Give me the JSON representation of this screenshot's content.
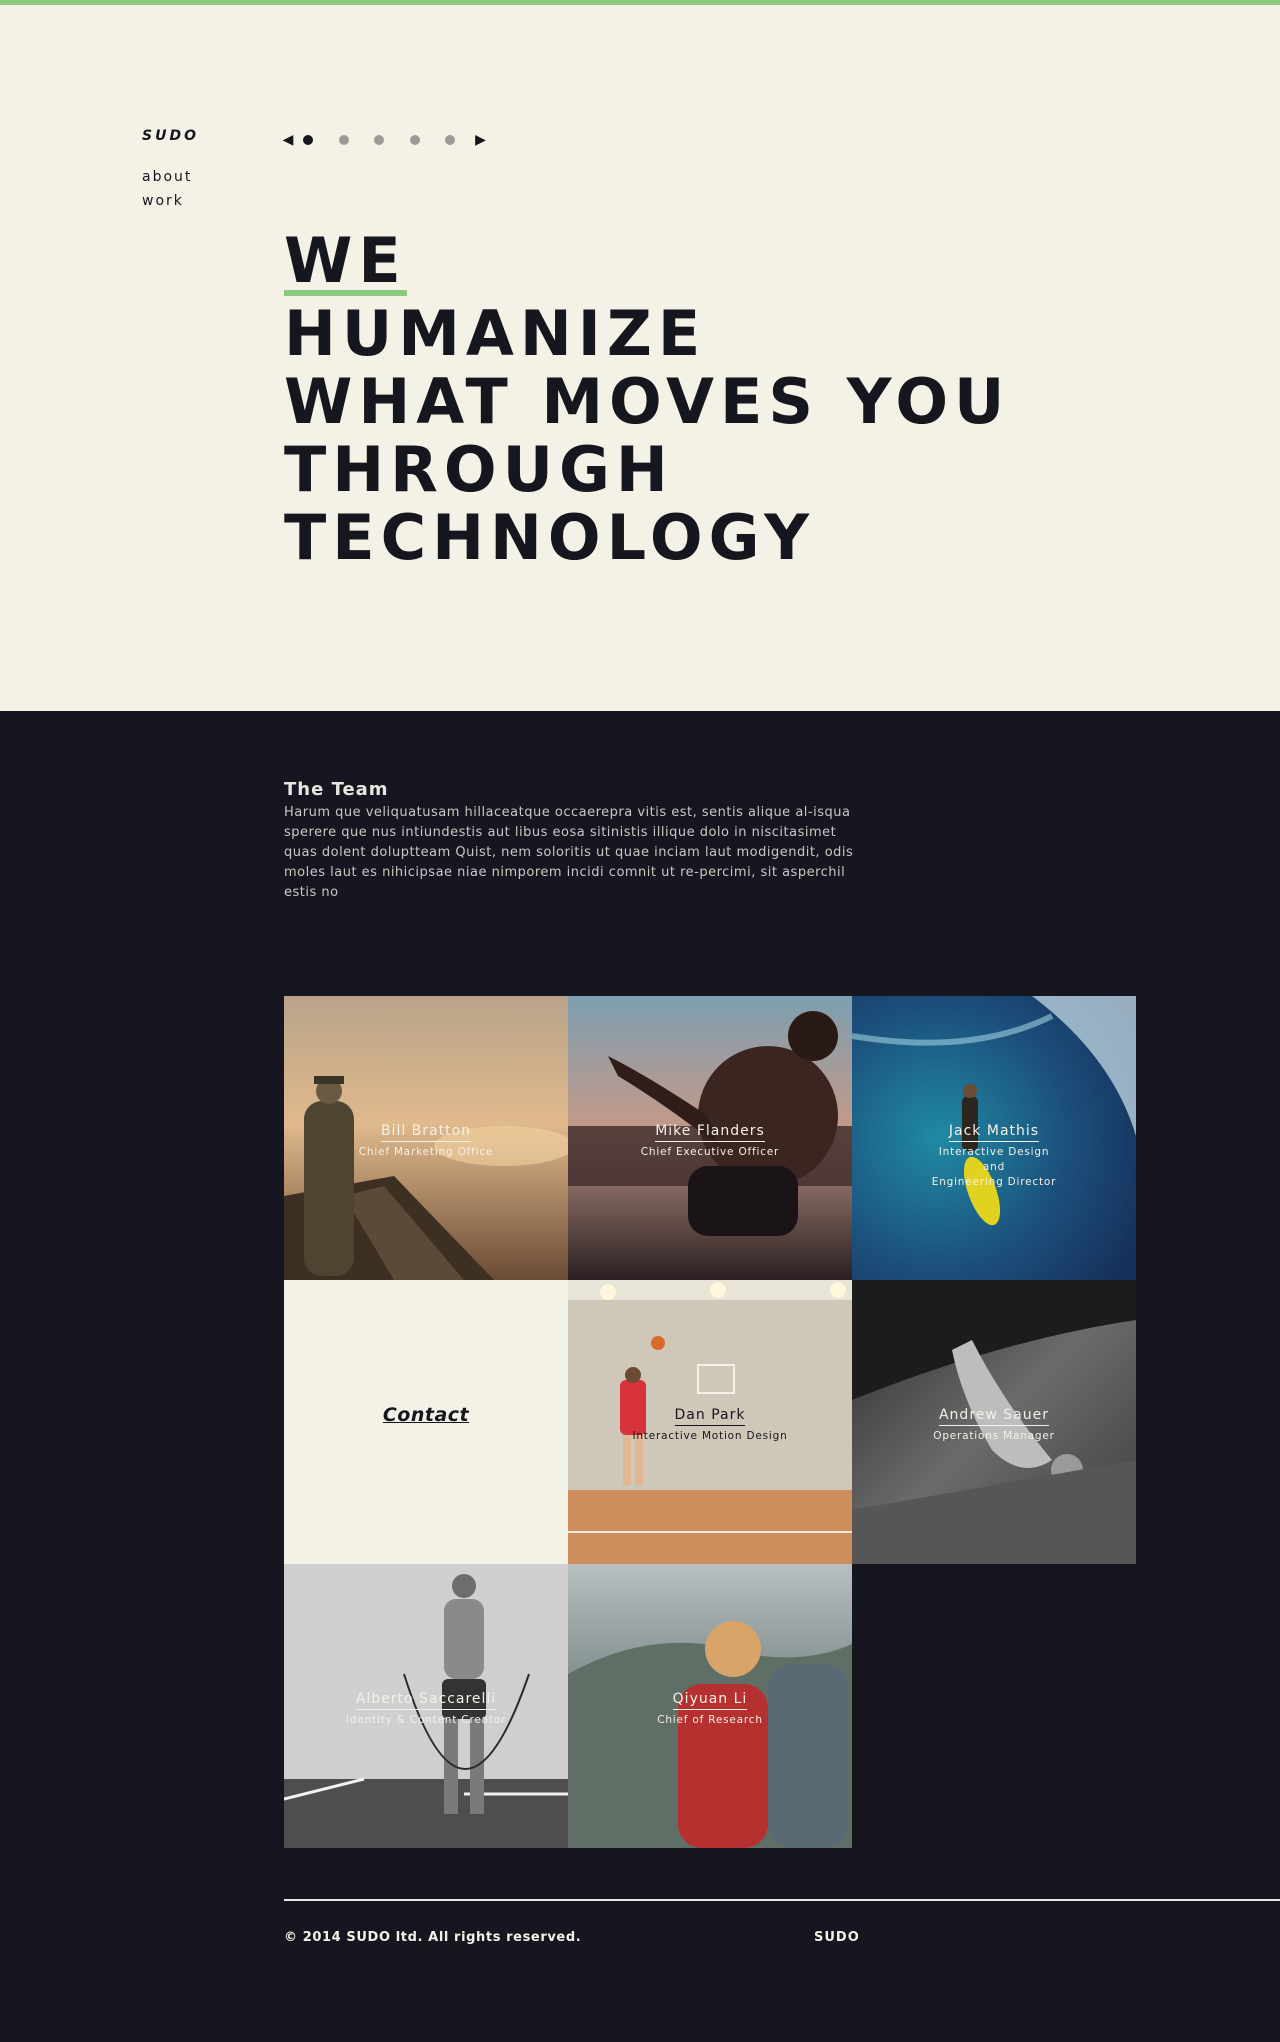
{
  "brand": {
    "logo": "SUDO",
    "accent_color": "#8bc97c",
    "dark_color": "#161620",
    "cream_color": "#f4f1e7"
  },
  "nav": {
    "items": [
      "about",
      "work"
    ]
  },
  "slider": {
    "prev": "◀",
    "next": "▶",
    "slide_count": 5,
    "active_index": 0
  },
  "hero": {
    "lines": [
      "WE",
      "HUMANIZE",
      "WHAT MOVES YOU",
      "THROUGH",
      "TECHNOLOGY"
    ]
  },
  "team": {
    "title": "The Team",
    "description": "Harum que veliquatusam hillaceatque occaerepra vitis est, sentis alique al-isqua sperere que nus intiundestis aut libus eosa sitinistis illique dolo in niscitasimet quas dolent doluptteam Quist, nem soloritis ut quae inciam laut modigendit, odis moles laut es nihicipsae niae nimporem incidi comnit ut re-percimi, sit asperchil estis no",
    "members": [
      {
        "name": "Bill Bratton",
        "role": "Chief Marketing Office"
      },
      {
        "name": "Mike Flanders",
        "role": "Chief Executive Officer"
      },
      {
        "name": "Jack Mathis",
        "role": "Interactive Design\nand\nEngineering Director"
      },
      {
        "name": "Dan Park",
        "role": "Interactive Motion Design"
      },
      {
        "name": "Andrew Sauer",
        "role": "Operations Manager"
      },
      {
        "name": "Alberto Saccarelli",
        "role": "Identity & Content Creator"
      },
      {
        "name": "Qiyuan Li",
        "role": "Chief of Research"
      }
    ],
    "contact_label": "Contact"
  },
  "footer": {
    "copyright": "© 2014 SUDO ltd. All rights reserved.",
    "logo": "SUDO"
  }
}
